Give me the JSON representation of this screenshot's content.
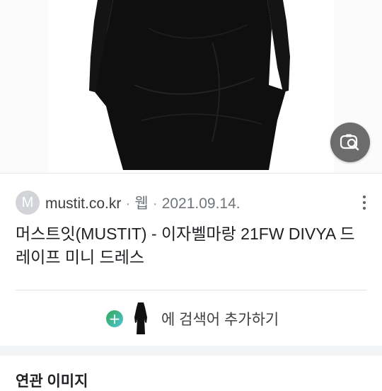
{
  "result": {
    "source_avatar_letter": "M",
    "source_domain": "mustit.co.kr",
    "source_type": "웹",
    "date": "2021.09.14.",
    "title": "머스트잇(MUSTIT) - 이자벨마랑 21FW DIVYA 드레이프 미니 드레스"
  },
  "actions": {
    "add_to_search_label": "에 검색어 추가하기"
  },
  "sections": {
    "related_images": "연관 이미지"
  },
  "icons": {
    "lens": "image-search-icon",
    "more": "more-vert-icon",
    "add": "plus-circle-icon"
  },
  "colors": {
    "lens_button": "#6c6c6c",
    "avatar_bg": "#d2d4d8",
    "dress": "#111111"
  }
}
